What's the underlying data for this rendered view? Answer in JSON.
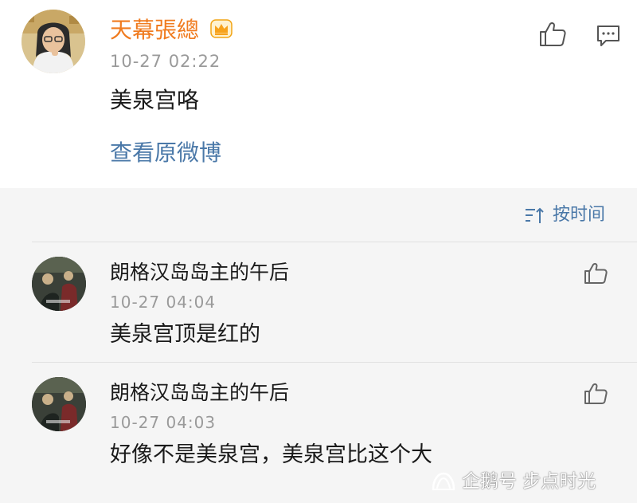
{
  "post": {
    "author": "天幕張總",
    "time": "10-27 02:22",
    "text": "美泉宫咯",
    "view_original": "查看原微博",
    "badge_icon": "vip-crown-icon",
    "like_icon": "thumbs-up-icon",
    "comment_icon": "comment-icon"
  },
  "comments_section": {
    "sort_label": "按时间",
    "sort_icon": "sort-icon"
  },
  "comments": [
    {
      "author": "朗格汉岛岛主的午后",
      "time": "10-27 04:04",
      "text": "美泉宫顶是红的"
    },
    {
      "author": "朗格汉岛岛主的午后",
      "time": "10-27 04:03",
      "text": "好像不是美泉宫，美泉宫比这个大"
    }
  ],
  "watermark": {
    "text": "企鹅号 步点时光"
  },
  "colors": {
    "author_name": "#f07b1f",
    "link": "#4a78a8",
    "timestamp": "#9a9a9a",
    "comments_background": "#f5f5f5"
  }
}
